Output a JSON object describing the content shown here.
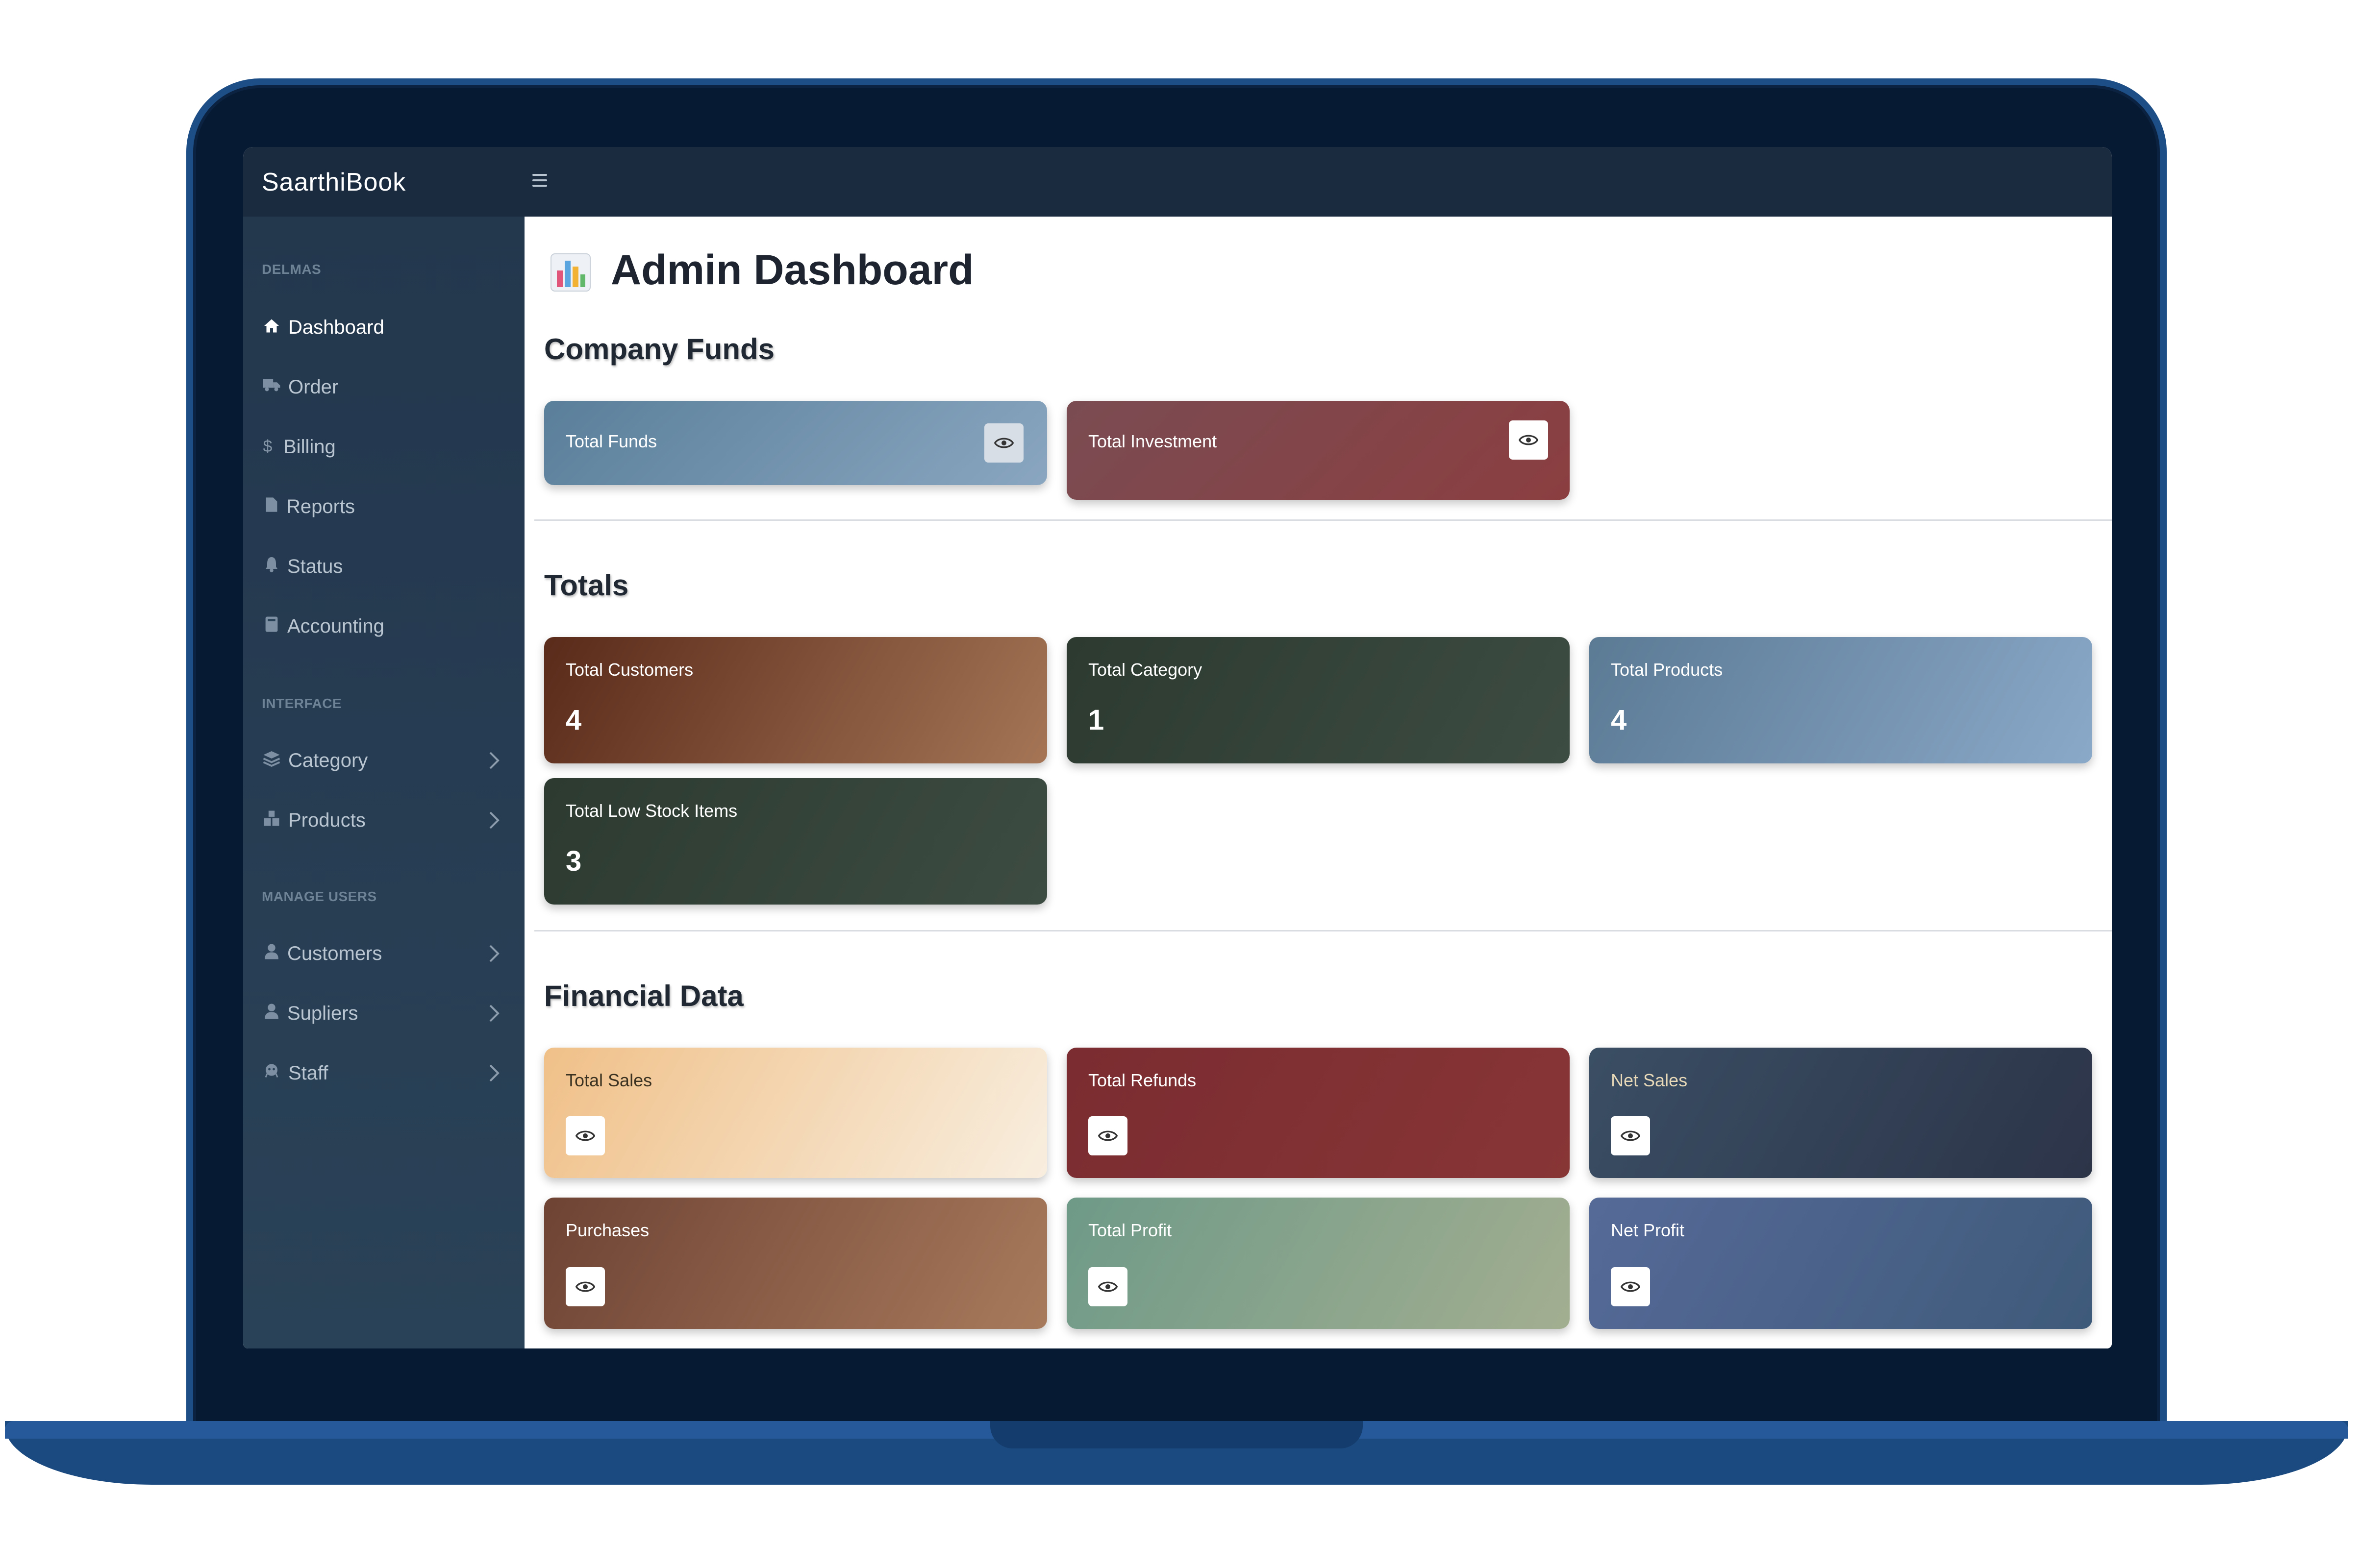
{
  "app": {
    "brand": "SaarthiBook"
  },
  "sidebar": {
    "headings": {
      "first": "DELMAS",
      "interface": "INTERFACE",
      "manage_users": "MANAGE USERS"
    },
    "items": [
      {
        "label": "Dashboard",
        "icon": "home-icon",
        "active": true
      },
      {
        "label": "Order",
        "icon": "truck-icon"
      },
      {
        "label": "Billing",
        "icon": "dollar-icon"
      },
      {
        "label": "Reports",
        "icon": "file-icon"
      },
      {
        "label": "Status",
        "icon": "bell-icon"
      },
      {
        "label": "Accounting",
        "icon": "book-icon"
      },
      {
        "label": "Category",
        "icon": "layers-icon",
        "expandable": true
      },
      {
        "label": "Products",
        "icon": "boxes-icon",
        "expandable": true
      },
      {
        "label": "Customers",
        "icon": "user-icon",
        "expandable": true
      },
      {
        "label": "Supliers",
        "icon": "user-icon",
        "expandable": true
      },
      {
        "label": "Staff",
        "icon": "staff-icon",
        "expandable": true
      }
    ]
  },
  "main": {
    "title": "Admin Dashboard",
    "sections": {
      "company_funds": "Company Funds",
      "totals": "Totals",
      "financial": "Financial Data"
    },
    "company_funds": [
      {
        "label": "Total Funds"
      },
      {
        "label": "Total Investment"
      }
    ],
    "totals": [
      {
        "label": "Total Customers",
        "value": "4"
      },
      {
        "label": "Total Category",
        "value": "1"
      },
      {
        "label": "Total Products",
        "value": "4"
      },
      {
        "label": "Total Low Stock Items",
        "value": "3"
      }
    ],
    "financial": [
      {
        "label": "Total Sales"
      },
      {
        "label": "Total Refunds"
      },
      {
        "label": "Net Sales"
      },
      {
        "label": "Purchases"
      },
      {
        "label": "Total Profit"
      },
      {
        "label": "Net Profit"
      }
    ]
  },
  "colors": {
    "sidebar_bg": "#23374d",
    "topbar_bg": "#1a2b40",
    "laptop_frame": "#0b2340"
  }
}
